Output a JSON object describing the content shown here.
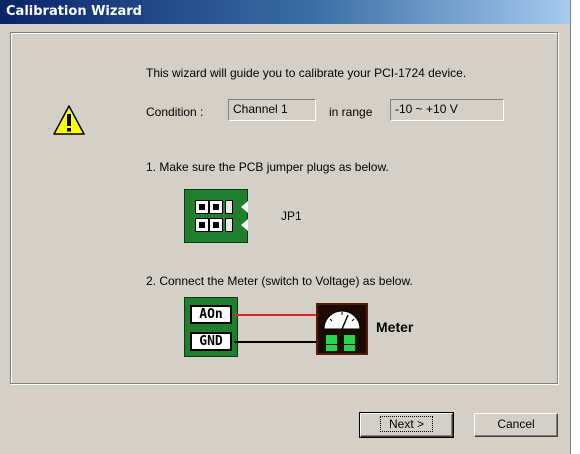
{
  "window": {
    "title": "Calibration Wizard"
  },
  "intro": "This wizard will guide you to calibrate your PCI-1724 device.",
  "condition": {
    "label": "Condition :",
    "channel_value": "Channel 1",
    "range_label": "in range",
    "range_value": "-10 ~ +10 V"
  },
  "step1": {
    "text": "1. Make sure the PCB jumper plugs as below.",
    "jumper_label": "JP1"
  },
  "step2": {
    "text": "2. Connect the Meter (switch to Voltage) as below.",
    "terminal_aon": "AOn",
    "terminal_gnd": "GND",
    "meter_label": "Meter"
  },
  "buttons": {
    "next": "Next >",
    "cancel": "Cancel"
  },
  "colors": {
    "pcb_green": "#1f7f2f",
    "wire_aon": "#e02020",
    "wire_gnd": "#000000",
    "warning_yellow": "#ffff00"
  },
  "icons": {
    "warning": "warning-icon",
    "jumper": "jumper-diagram",
    "meter": "voltmeter-icon"
  }
}
